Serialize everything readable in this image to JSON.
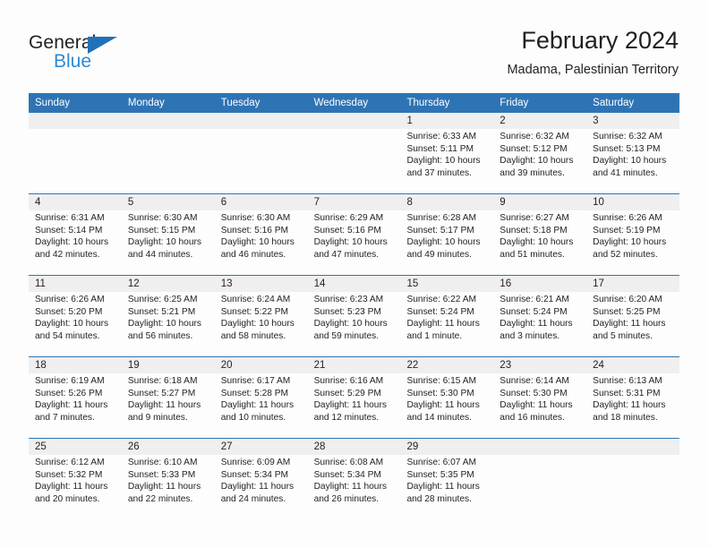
{
  "brand": {
    "name_part1": "General",
    "name_part2": "Blue",
    "triangle_color": "#1f72b8",
    "blue_color": "#2b8ad6"
  },
  "header": {
    "title": "February 2024",
    "subtitle": "Madama, Palestinian Territory"
  },
  "theme": {
    "header_blue": "#2e74b5",
    "row_band_gray": "#efefef",
    "text": "#231f20",
    "page_background": "#fdfdfd"
  },
  "weekdays": [
    "Sunday",
    "Monday",
    "Tuesday",
    "Wednesday",
    "Thursday",
    "Friday",
    "Saturday"
  ],
  "weeks": [
    [
      {
        "day": "",
        "sunrise": "",
        "sunset": "",
        "daylight": "",
        "empty": true
      },
      {
        "day": "",
        "sunrise": "",
        "sunset": "",
        "daylight": "",
        "empty": true
      },
      {
        "day": "",
        "sunrise": "",
        "sunset": "",
        "daylight": "",
        "empty": true
      },
      {
        "day": "",
        "sunrise": "",
        "sunset": "",
        "daylight": "",
        "empty": true
      },
      {
        "day": "1",
        "sunrise": "Sunrise: 6:33 AM",
        "sunset": "Sunset: 5:11 PM",
        "daylight": "Daylight: 10 hours and 37 minutes."
      },
      {
        "day": "2",
        "sunrise": "Sunrise: 6:32 AM",
        "sunset": "Sunset: 5:12 PM",
        "daylight": "Daylight: 10 hours and 39 minutes."
      },
      {
        "day": "3",
        "sunrise": "Sunrise: 6:32 AM",
        "sunset": "Sunset: 5:13 PM",
        "daylight": "Daylight: 10 hours and 41 minutes."
      }
    ],
    [
      {
        "day": "4",
        "sunrise": "Sunrise: 6:31 AM",
        "sunset": "Sunset: 5:14 PM",
        "daylight": "Daylight: 10 hours and 42 minutes."
      },
      {
        "day": "5",
        "sunrise": "Sunrise: 6:30 AM",
        "sunset": "Sunset: 5:15 PM",
        "daylight": "Daylight: 10 hours and 44 minutes."
      },
      {
        "day": "6",
        "sunrise": "Sunrise: 6:30 AM",
        "sunset": "Sunset: 5:16 PM",
        "daylight": "Daylight: 10 hours and 46 minutes."
      },
      {
        "day": "7",
        "sunrise": "Sunrise: 6:29 AM",
        "sunset": "Sunset: 5:16 PM",
        "daylight": "Daylight: 10 hours and 47 minutes."
      },
      {
        "day": "8",
        "sunrise": "Sunrise: 6:28 AM",
        "sunset": "Sunset: 5:17 PM",
        "daylight": "Daylight: 10 hours and 49 minutes."
      },
      {
        "day": "9",
        "sunrise": "Sunrise: 6:27 AM",
        "sunset": "Sunset: 5:18 PM",
        "daylight": "Daylight: 10 hours and 51 minutes."
      },
      {
        "day": "10",
        "sunrise": "Sunrise: 6:26 AM",
        "sunset": "Sunset: 5:19 PM",
        "daylight": "Daylight: 10 hours and 52 minutes."
      }
    ],
    [
      {
        "day": "11",
        "sunrise": "Sunrise: 6:26 AM",
        "sunset": "Sunset: 5:20 PM",
        "daylight": "Daylight: 10 hours and 54 minutes."
      },
      {
        "day": "12",
        "sunrise": "Sunrise: 6:25 AM",
        "sunset": "Sunset: 5:21 PM",
        "daylight": "Daylight: 10 hours and 56 minutes."
      },
      {
        "day": "13",
        "sunrise": "Sunrise: 6:24 AM",
        "sunset": "Sunset: 5:22 PM",
        "daylight": "Daylight: 10 hours and 58 minutes."
      },
      {
        "day": "14",
        "sunrise": "Sunrise: 6:23 AM",
        "sunset": "Sunset: 5:23 PM",
        "daylight": "Daylight: 10 hours and 59 minutes."
      },
      {
        "day": "15",
        "sunrise": "Sunrise: 6:22 AM",
        "sunset": "Sunset: 5:24 PM",
        "daylight": "Daylight: 11 hours and 1 minute."
      },
      {
        "day": "16",
        "sunrise": "Sunrise: 6:21 AM",
        "sunset": "Sunset: 5:24 PM",
        "daylight": "Daylight: 11 hours and 3 minutes."
      },
      {
        "day": "17",
        "sunrise": "Sunrise: 6:20 AM",
        "sunset": "Sunset: 5:25 PM",
        "daylight": "Daylight: 11 hours and 5 minutes."
      }
    ],
    [
      {
        "day": "18",
        "sunrise": "Sunrise: 6:19 AM",
        "sunset": "Sunset: 5:26 PM",
        "daylight": "Daylight: 11 hours and 7 minutes."
      },
      {
        "day": "19",
        "sunrise": "Sunrise: 6:18 AM",
        "sunset": "Sunset: 5:27 PM",
        "daylight": "Daylight: 11 hours and 9 minutes."
      },
      {
        "day": "20",
        "sunrise": "Sunrise: 6:17 AM",
        "sunset": "Sunset: 5:28 PM",
        "daylight": "Daylight: 11 hours and 10 minutes."
      },
      {
        "day": "21",
        "sunrise": "Sunrise: 6:16 AM",
        "sunset": "Sunset: 5:29 PM",
        "daylight": "Daylight: 11 hours and 12 minutes."
      },
      {
        "day": "22",
        "sunrise": "Sunrise: 6:15 AM",
        "sunset": "Sunset: 5:30 PM",
        "daylight": "Daylight: 11 hours and 14 minutes."
      },
      {
        "day": "23",
        "sunrise": "Sunrise: 6:14 AM",
        "sunset": "Sunset: 5:30 PM",
        "daylight": "Daylight: 11 hours and 16 minutes."
      },
      {
        "day": "24",
        "sunrise": "Sunrise: 6:13 AM",
        "sunset": "Sunset: 5:31 PM",
        "daylight": "Daylight: 11 hours and 18 minutes."
      }
    ],
    [
      {
        "day": "25",
        "sunrise": "Sunrise: 6:12 AM",
        "sunset": "Sunset: 5:32 PM",
        "daylight": "Daylight: 11 hours and 20 minutes."
      },
      {
        "day": "26",
        "sunrise": "Sunrise: 6:10 AM",
        "sunset": "Sunset: 5:33 PM",
        "daylight": "Daylight: 11 hours and 22 minutes."
      },
      {
        "day": "27",
        "sunrise": "Sunrise: 6:09 AM",
        "sunset": "Sunset: 5:34 PM",
        "daylight": "Daylight: 11 hours and 24 minutes."
      },
      {
        "day": "28",
        "sunrise": "Sunrise: 6:08 AM",
        "sunset": "Sunset: 5:34 PM",
        "daylight": "Daylight: 11 hours and 26 minutes."
      },
      {
        "day": "29",
        "sunrise": "Sunrise: 6:07 AM",
        "sunset": "Sunset: 5:35 PM",
        "daylight": "Daylight: 11 hours and 28 minutes."
      },
      {
        "day": "",
        "sunrise": "",
        "sunset": "",
        "daylight": "",
        "empty": true
      },
      {
        "day": "",
        "sunrise": "",
        "sunset": "",
        "daylight": "",
        "empty": true
      }
    ]
  ]
}
